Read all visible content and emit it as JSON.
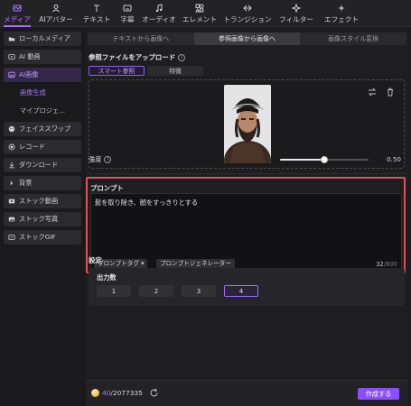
{
  "topbar": {
    "items": [
      {
        "label": "メディア",
        "icon": "media-icon",
        "active": true
      },
      {
        "label": "AIアバター",
        "icon": "ai-avatar-icon",
        "active": false
      },
      {
        "label": "テキスト",
        "icon": "text-icon",
        "active": false
      },
      {
        "label": "字幕",
        "icon": "subtitle-icon",
        "active": false
      },
      {
        "label": "オーディオ",
        "icon": "audio-icon",
        "active": false
      },
      {
        "label": "エレメント",
        "icon": "element-icon",
        "active": false
      },
      {
        "label": "トランジション",
        "icon": "transition-icon",
        "active": false
      },
      {
        "label": "フィルター",
        "icon": "filter-icon",
        "active": false
      },
      {
        "label": "エフェクト",
        "icon": "effect-icon",
        "active": false
      }
    ]
  },
  "sidebar": {
    "items": [
      {
        "label": "ローカルメディア",
        "icon": "folder-icon"
      },
      {
        "label": "AI 動画",
        "icon": "ai-video-icon"
      },
      {
        "label": "AI画像",
        "icon": "ai-image-icon",
        "active": true
      },
      {
        "label": "画像生成",
        "sub": true,
        "active": true
      },
      {
        "label": "マイプロジェ...",
        "sub": true
      },
      {
        "label": "フェイススワップ",
        "icon": "face-swap-icon"
      },
      {
        "label": "レコード",
        "icon": "record-icon"
      },
      {
        "label": "ダウンロード",
        "icon": "download-icon"
      },
      {
        "label": "背景",
        "icon": "chevron-right-icon"
      },
      {
        "label": "ストック動画",
        "icon": "stock-video-icon"
      },
      {
        "label": "ストック写真",
        "icon": "stock-photo-icon"
      },
      {
        "label": "ストックGIF",
        "icon": "stock-gif-icon"
      }
    ]
  },
  "main": {
    "tabs": [
      {
        "label": "テキストから画像へ",
        "active": false
      },
      {
        "label": "参照画像から画像へ",
        "active": true
      },
      {
        "label": "画像スタイル変換",
        "active": false
      }
    ],
    "upload_label": "参照ファイルをアップロード",
    "subtabs": [
      {
        "label": "スマート参照",
        "active": true
      },
      {
        "label": "特徴",
        "active": false
      }
    ],
    "strength": {
      "label": "強度",
      "value": "0.50",
      "fraction": 0.5
    },
    "prompt": {
      "title": "プロンプト",
      "text": "髭を取り除き、顔をすっきりとする",
      "tag_button": "プロンプトタグ",
      "generator_button": "プロンプトジェネレーター",
      "count": "32",
      "max": "/800"
    },
    "settings": {
      "label": "設定",
      "count_label": "出力数",
      "options": [
        "1",
        "2",
        "3",
        "4"
      ],
      "selected": "4"
    }
  },
  "bottom": {
    "credits_current": "40",
    "credits_total": "/2077335",
    "create_button": "作成する"
  },
  "colors": {
    "accent": "#8a4dff",
    "highlight_border": "#e0505a"
  }
}
